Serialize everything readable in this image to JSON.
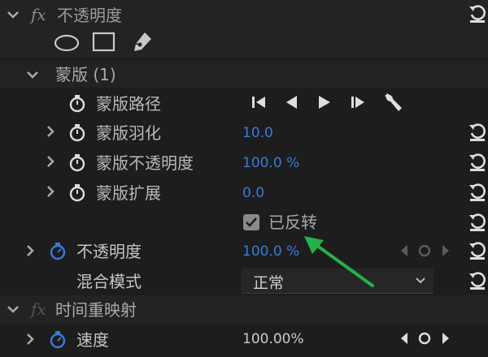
{
  "colors": {
    "accent": "#3b7ad6",
    "arrow": "#22b24a",
    "panel": "#1e1e1e"
  },
  "opacity_effect": {
    "fx_label": "fx",
    "title": "不透明度",
    "shape_tools": [
      "ellipse-icon",
      "rectangle-icon",
      "pen-icon"
    ]
  },
  "mask": {
    "title": "蒙版 (1)",
    "path_label": "蒙版路径",
    "path_controls": [
      "track-prev-icon",
      "step-back-icon",
      "play-icon",
      "track-next-icon",
      "wrench-icon"
    ],
    "feather_label": "蒙版羽化",
    "feather_value": "10.0",
    "opacity_label": "蒙版不透明度",
    "opacity_value": "100.0 %",
    "expansion_label": "蒙版扩展",
    "expansion_value": "0.0",
    "inverted_label": "已反转",
    "inverted_checked": true
  },
  "opacity": {
    "label": "不透明度",
    "value": "100.0 %"
  },
  "blend": {
    "label": "混合模式",
    "selected": "正常"
  },
  "time_remap": {
    "fx_label": "fx",
    "title": "时间重映射",
    "speed_label": "速度",
    "speed_value": "100.00%"
  }
}
